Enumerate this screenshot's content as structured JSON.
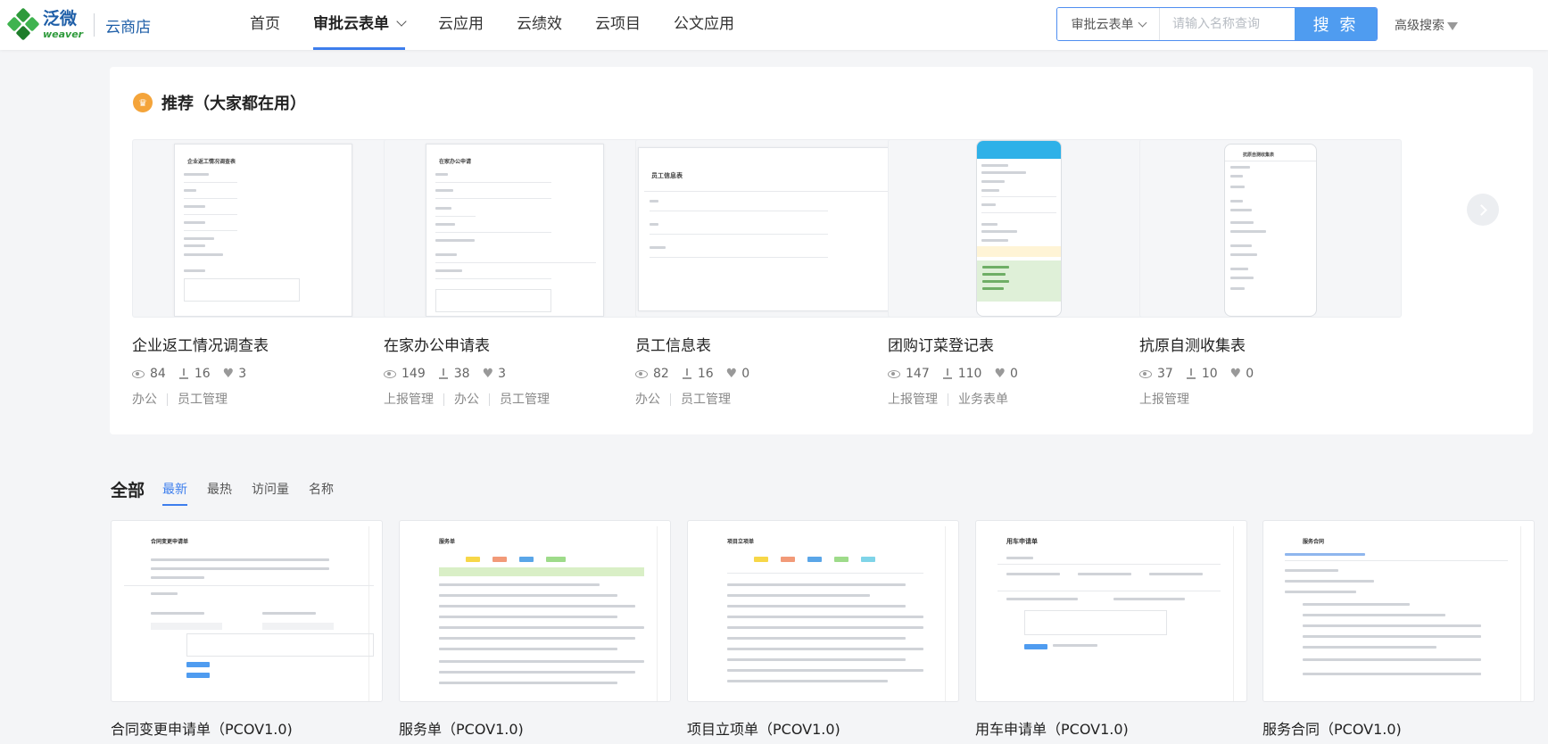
{
  "header": {
    "logo_cn": "泛微",
    "logo_en": "weaver",
    "store": "云商店",
    "nav": [
      {
        "label": "首页",
        "active": false
      },
      {
        "label": "审批云表单",
        "active": true
      },
      {
        "label": "云应用",
        "active": false
      },
      {
        "label": "云绩效",
        "active": false
      },
      {
        "label": "云项目",
        "active": false
      },
      {
        "label": "公文应用",
        "active": false
      }
    ],
    "search": {
      "scope": "审批云表单",
      "placeholder": "请输入名称查询",
      "button": "搜 索"
    },
    "advanced": "高级搜索"
  },
  "recommend": {
    "title": "推荐（大家都在用）",
    "cards": [
      {
        "title": "企业返工情况调查表",
        "views": "84",
        "downloads": "16",
        "likes": "3",
        "tags": [
          "办公",
          "员工管理"
        ],
        "thumb": "企业返工情况调查表"
      },
      {
        "title": "在家办公申请表",
        "views": "149",
        "downloads": "38",
        "likes": "3",
        "tags": [
          "上报管理",
          "办公",
          "员工管理"
        ],
        "thumb": "在家办公申请"
      },
      {
        "title": "员工信息表",
        "views": "82",
        "downloads": "16",
        "likes": "0",
        "tags": [
          "办公",
          "员工管理"
        ],
        "thumb": "员工信息表"
      },
      {
        "title": "团购订菜登记表",
        "views": "147",
        "downloads": "110",
        "likes": "0",
        "tags": [
          "上报管理",
          "业务表单"
        ],
        "thumb": ""
      },
      {
        "title": "抗原自测收集表",
        "views": "37",
        "downloads": "10",
        "likes": "0",
        "tags": [
          "上报管理"
        ],
        "thumb": "抗原自测收集表"
      }
    ]
  },
  "all": {
    "title": "全部",
    "sorts": [
      {
        "label": "最新",
        "active": true
      },
      {
        "label": "最热",
        "active": false
      },
      {
        "label": "访问量",
        "active": false
      },
      {
        "label": "名称",
        "active": false
      }
    ],
    "cards": [
      {
        "title": "合同变更申请单（PCOV1.0)",
        "thumb": "合同变更申请单"
      },
      {
        "title": "服务单（PCOV1.0)",
        "thumb": "服务单"
      },
      {
        "title": "项目立项单（PCOV1.0)",
        "thumb": "项目立项单"
      },
      {
        "title": "用车申请单（PCOV1.0)",
        "thumb": "用车申请单"
      },
      {
        "title": "服务合同（PCOV1.0)",
        "thumb": "服务合同"
      }
    ]
  },
  "colors": {
    "accent": "#3d7eed",
    "search_button": "#4f9cf0",
    "crown": "#f4a43a",
    "brand_blue": "#1f5fa8",
    "brand_green": "#2e9a3b"
  },
  "icons": [
    "crown-icon",
    "eye-icon",
    "download-icon",
    "heart-icon",
    "chevron-down-icon",
    "funnel-icon",
    "chevron-right-icon"
  ]
}
